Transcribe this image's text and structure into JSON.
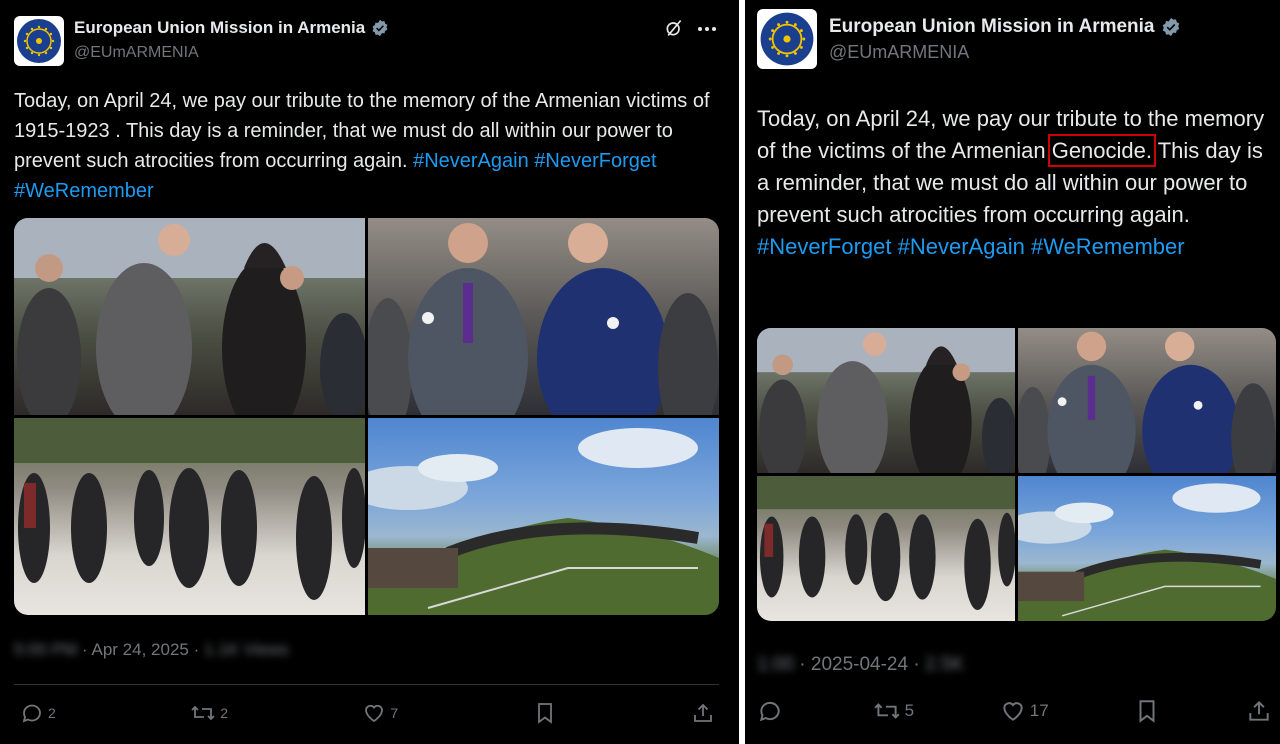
{
  "left": {
    "account_name": "European Union Mission in Armenia",
    "handle": "@EUmARMENIA",
    "text_plain_1": "Today, on April 24, we pay our tribute to the memory of the Armenian victims of 1915-1923 . This day is a reminder, that we must do all within our power to prevent such atrocities from occurring again. ",
    "tags": [
      "#NeverAgain",
      "#NeverForget",
      "#WeRemember"
    ],
    "time_blurred": "5:00 PM",
    "date": "Apr 24, 2025",
    "views_blurred": "1.1K Views",
    "counts": {
      "replies": "2",
      "reposts": "2",
      "likes": "7"
    }
  },
  "right": {
    "account_name": "European Union Mission in Armenia",
    "handle": "@EUmARMENIA",
    "text_plain_1": "Today, on April 24, we pay our tribute to the memory of the victims of the Armenian ",
    "highlight_word": "Genocide.",
    "text_plain_2": " This day is a reminder, that we must do all within our power to prevent such atrocities from occurring again. ",
    "tags": [
      "#NeverForget",
      "#NeverAgain",
      "#WeRemember"
    ],
    "time_blurred": "1:00",
    "date": "2025-04-24",
    "views_blurred": "2.5K",
    "counts": {
      "replies": "",
      "reposts": "5",
      "likes": "17"
    }
  },
  "logo_text": "EUROPEAN UNION MISSION ARMENIA",
  "colors": {
    "accent": "#1d9bf0",
    "muted": "#71767b",
    "highlight_box": "#d10000"
  }
}
